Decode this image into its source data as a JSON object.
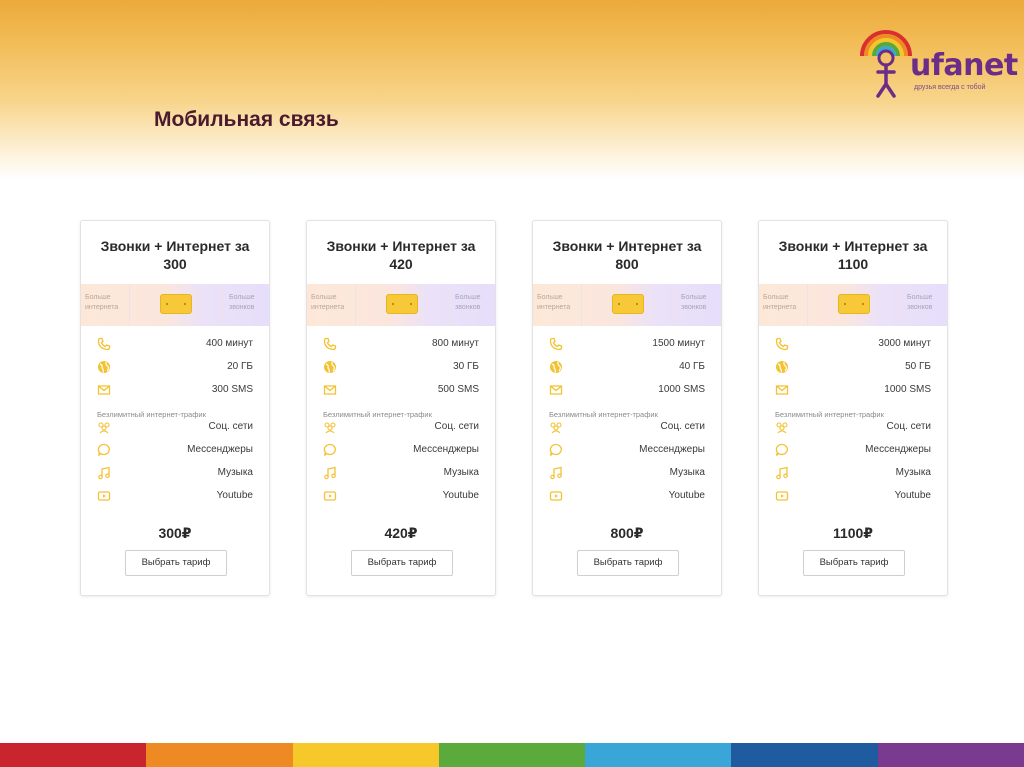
{
  "slide": {
    "title": "Мобильная связь"
  },
  "logo": {
    "text": "ufanet",
    "tagline": "друзья всегда с тобой"
  },
  "slider_labels": {
    "more_internet": "Больше интернета",
    "more_calls": "Больше звонков"
  },
  "unlimited_label": "Безлимитный интернет-трафик",
  "unlimited_items": [
    "Соц. сети",
    "Мессенджеры",
    "Музыка",
    "Youtube"
  ],
  "button_label": "Выбрать тариф",
  "icons": [
    "phone-icon",
    "globe-icon",
    "mail-icon",
    "social-icon",
    "chat-icon",
    "music-icon",
    "youtube-icon"
  ],
  "colors": {
    "accent": "#f5c232",
    "title": "#4a1a2e",
    "logo": "#6b2d87",
    "rainbow": [
      "#c8252c",
      "#ee8a24",
      "#f7c82a",
      "#5aaa3c",
      "#3aa6d8",
      "#1f5b9f",
      "#7a3a8f"
    ]
  },
  "tariffs": [
    {
      "title": "Звонки + Интернет за 300",
      "minutes": "400 минут",
      "data": "20 ГБ",
      "sms": "300 SMS",
      "price": "300₽"
    },
    {
      "title": "Звонки + Интернет за 420",
      "minutes": "800 минут",
      "data": "30 ГБ",
      "sms": "500 SMS",
      "price": "420₽"
    },
    {
      "title": "Звонки + Интернет за 800",
      "minutes": "1500 минут",
      "data": "40 ГБ",
      "sms": "1000 SMS",
      "price": "800₽"
    },
    {
      "title": "Звонки + Интернет за 1100",
      "minutes": "3000 минут",
      "data": "50 ГБ",
      "sms": "1000 SMS",
      "price": "1100₽"
    }
  ]
}
